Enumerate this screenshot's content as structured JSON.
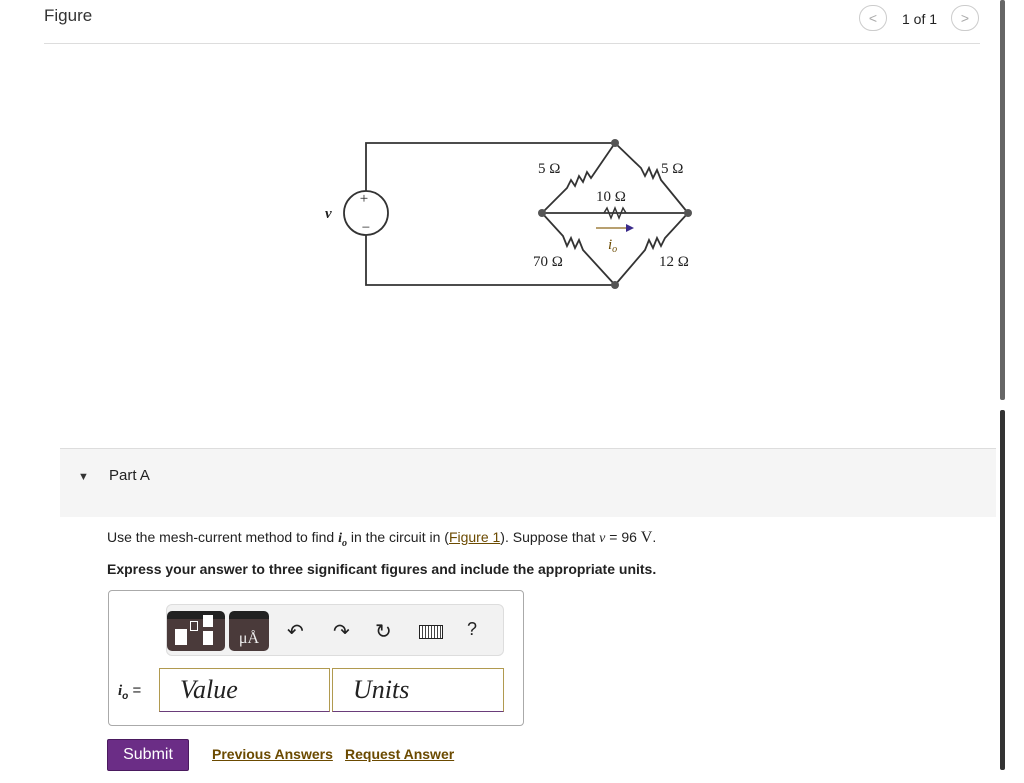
{
  "figure": {
    "title": "Figure",
    "pager": "1 of 1",
    "prev_icon": "chevron-left-icon",
    "next_icon": "chevron-right-icon"
  },
  "circuit": {
    "source_label": "v",
    "plus": "+",
    "minus": "−",
    "r_top_left": "5 Ω",
    "r_top_right": "5 Ω",
    "r_middle": "10 Ω",
    "r_bottom_left": "70 Ω",
    "r_bottom_right": "12 Ω",
    "current_label": "i",
    "current_sub": "o",
    "arrow_color": "#3a2a8a"
  },
  "part": {
    "label": "Part A"
  },
  "question": {
    "pre": "Use the mesh-current method to find ",
    "var": "i",
    "sub": "o",
    "mid": " in the circuit in (",
    "link": "Figure 1",
    "post": "). Suppose that ",
    "v": "v",
    "eq": " = 96 ",
    "unit": "V",
    "end": "."
  },
  "instruction": "Express your answer to three significant figures and include the appropriate units.",
  "toolbar": {
    "units_btn": "μÅ",
    "help": "?"
  },
  "answer": {
    "label_var": "i",
    "label_sub": "o",
    "label_eq": " =",
    "value_placeholder": "Value",
    "units_placeholder": "Units"
  },
  "actions": {
    "submit": "Submit",
    "previous": "Previous Answers",
    "request": "Request Answer"
  },
  "colors": {
    "accent": "#6b2d86",
    "link": "#6b4a00"
  }
}
